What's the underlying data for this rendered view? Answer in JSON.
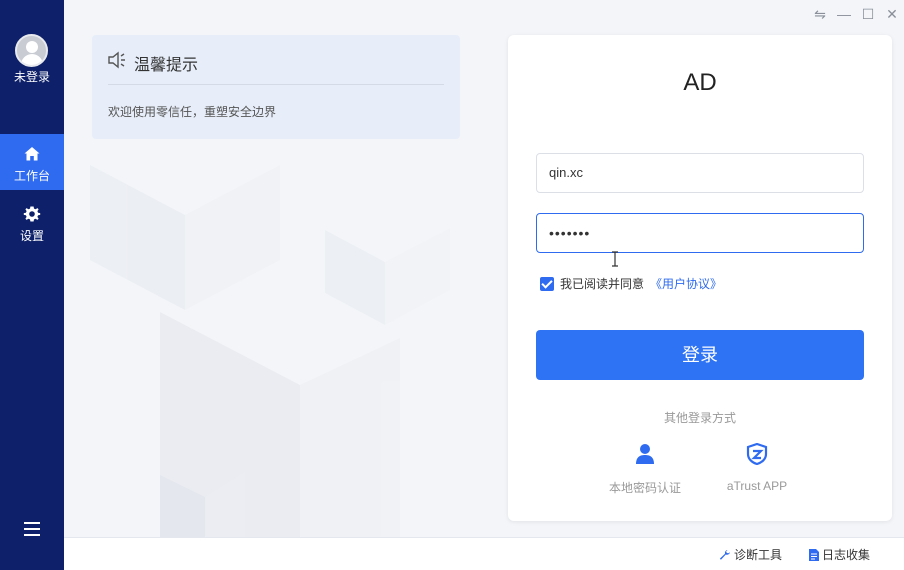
{
  "sidebar": {
    "user_label": "未登录",
    "items": [
      {
        "label": "工作台",
        "icon": "home-icon",
        "active": true
      },
      {
        "label": "设置",
        "icon": "gear-icon",
        "active": false
      }
    ],
    "menu_icon": "hamburger-icon"
  },
  "window_controls": [
    "swap-icon",
    "minimize-icon",
    "maximize-icon",
    "close-icon"
  ],
  "notice": {
    "icon": "speaker-icon",
    "title": "温馨提示",
    "text": "欢迎使用零信任，重塑安全边界"
  },
  "login": {
    "title": "AD",
    "username_value": "qin.xc",
    "password_value": "•••••••",
    "agree_text": "我已阅读并同意",
    "agree_link": "《用户协议》",
    "agree_checked": true,
    "submit_label": "登录",
    "other_label": "其他登录方式",
    "alt_methods": [
      {
        "label": "本地密码认证",
        "icon": "user-icon"
      },
      {
        "label": "aTrust APP",
        "icon": "atrust-shield-icon"
      }
    ]
  },
  "statusbar": {
    "items": [
      {
        "label": "诊断工具",
        "icon": "wrench-icon"
      },
      {
        "label": "日志收集",
        "icon": "document-icon"
      }
    ]
  },
  "colors": {
    "sidebar": "#0d2069",
    "accent": "#2f6bf0",
    "button": "#2f73f5"
  }
}
